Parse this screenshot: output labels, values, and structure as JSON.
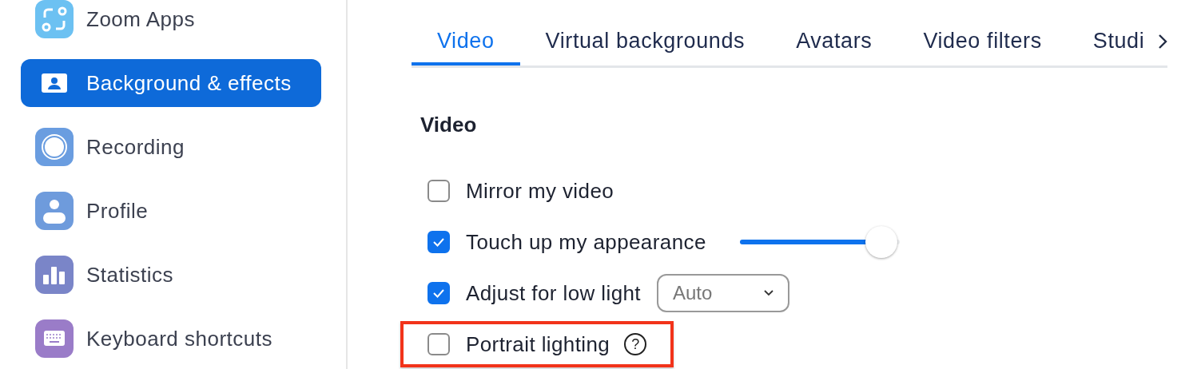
{
  "sidebar": {
    "items": [
      {
        "label": "Zoom Apps",
        "selected": false
      },
      {
        "label": "Background & effects",
        "selected": true
      },
      {
        "label": "Recording",
        "selected": false
      },
      {
        "label": "Profile",
        "selected": false
      },
      {
        "label": "Statistics",
        "selected": false
      },
      {
        "label": "Keyboard shortcuts",
        "selected": false
      }
    ]
  },
  "tabs": [
    {
      "label": "Video",
      "selected": true
    },
    {
      "label": "Virtual backgrounds",
      "selected": false
    },
    {
      "label": "Avatars",
      "selected": false
    },
    {
      "label": "Video filters",
      "selected": false
    },
    {
      "label": "Studi",
      "selected": false
    }
  ],
  "section": {
    "title": "Video",
    "options": [
      {
        "kind": "plain",
        "label": "Mirror my video",
        "checked": false,
        "highlighted": false
      },
      {
        "kind": "slider",
        "label": "Touch up my appearance",
        "checked": true,
        "level": 0.82,
        "highlighted": false
      },
      {
        "kind": "select",
        "label": "Adjust for low light",
        "checked": true,
        "value": "Auto",
        "highlighted": false
      },
      {
        "kind": "help",
        "label": "Portrait lighting",
        "checked": false,
        "help": "?",
        "highlighted": true
      }
    ]
  }
}
